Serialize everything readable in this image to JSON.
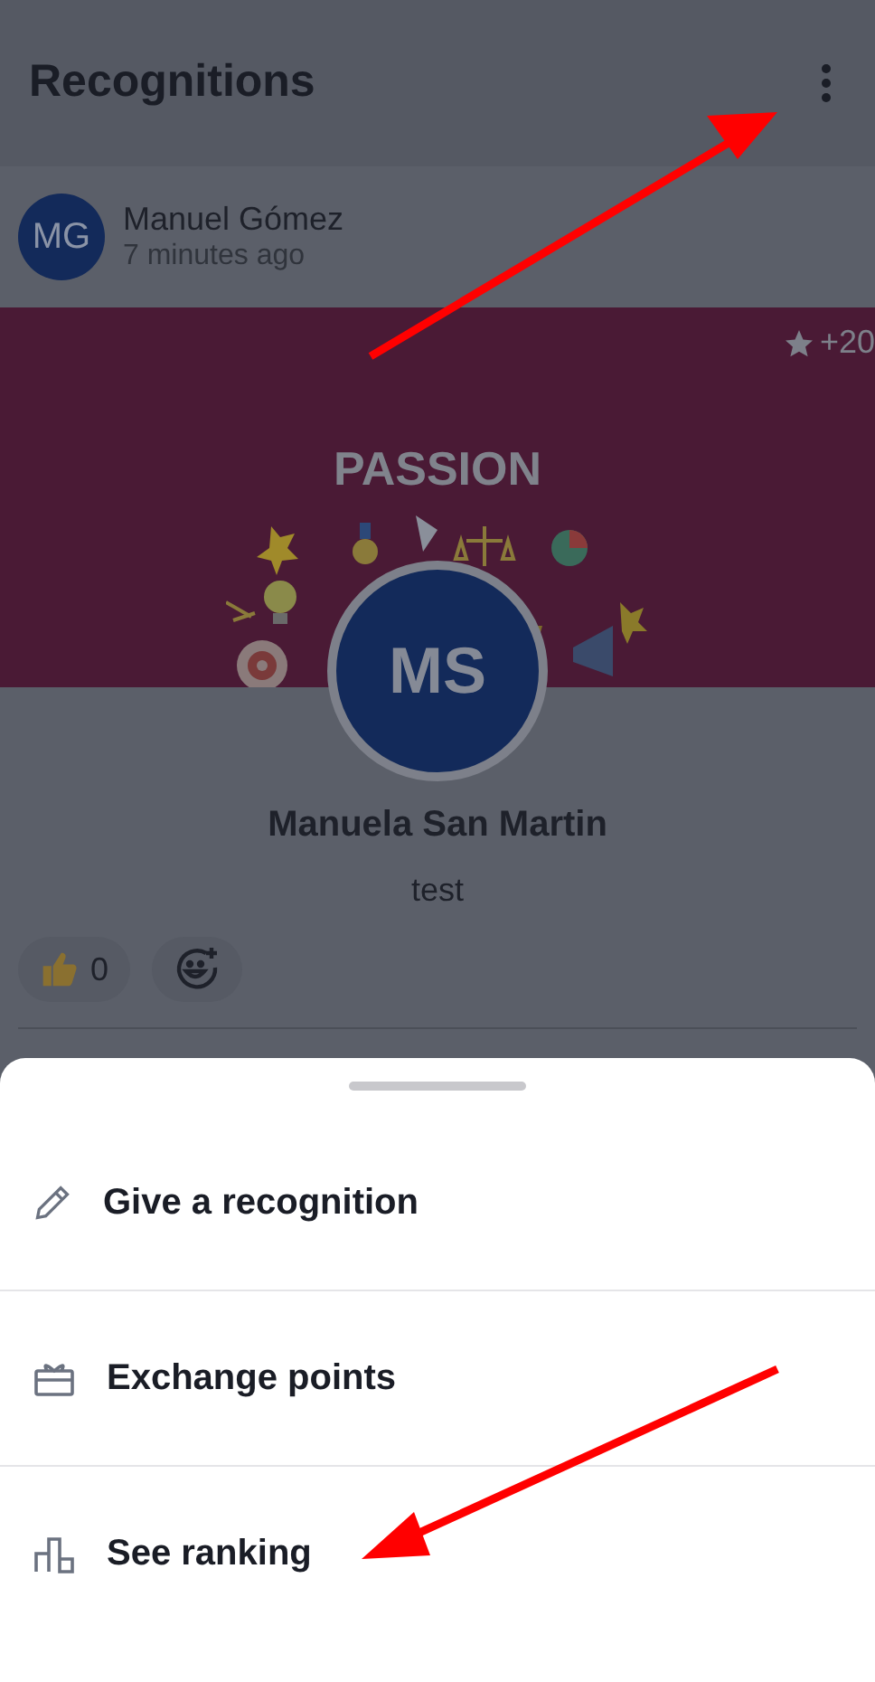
{
  "header": {
    "title": "Recognitions"
  },
  "post": {
    "author_initials": "MG",
    "author": "Manuel Gómez",
    "time": "7 minutes ago",
    "points": "+20",
    "value": "PASSION",
    "recipient_initials": "MS",
    "recipient": "Manuela San Martin",
    "message": "test",
    "reactions": [
      {
        "kind": "thumbs",
        "count": "0"
      },
      {
        "kind": "add"
      }
    ]
  },
  "sheet": {
    "items": [
      {
        "kind": "pencil",
        "label": "Give a recognition"
      },
      {
        "kind": "gift",
        "label": "Exchange points"
      },
      {
        "kind": "ranking",
        "label": "See ranking"
      }
    ]
  }
}
